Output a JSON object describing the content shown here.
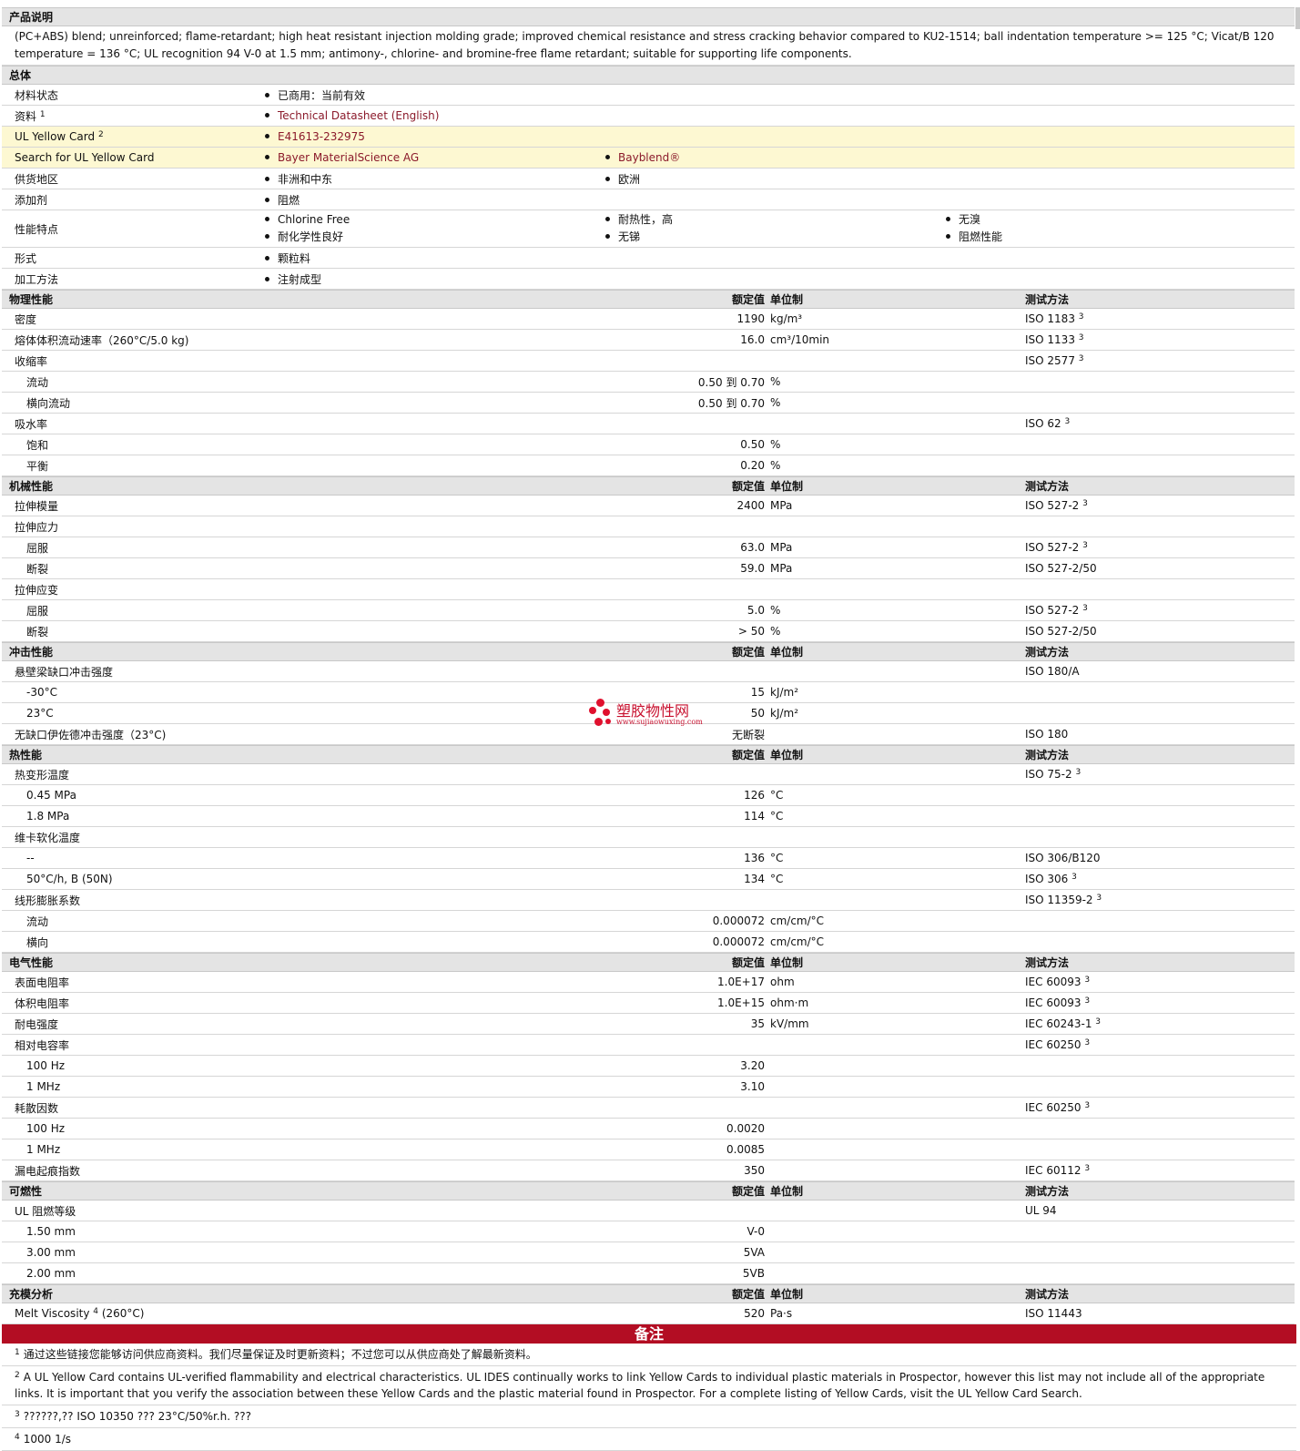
{
  "description": {
    "heading": "产品说明",
    "text": "(PC+ABS) blend; unreinforced; flame-retardant; high heat resistant injection molding grade; improved chemical resistance and stress cracking behavior compared to KU2-1514; ball indentation temperature >= 125 °C; Vicat/B 120 temperature = 136 °C; UL recognition 94 V-0 at 1.5 mm; antimony-, chlorine- and bromine-free flame retardant; suitable for supporting life components."
  },
  "general": {
    "heading": "总体",
    "rows": [
      {
        "label": "材料状态",
        "sup": "",
        "cols": [
          [
            "已商用：当前有效"
          ]
        ],
        "link": false,
        "yellow": false
      },
      {
        "label": "资料",
        "sup": "1",
        "cols": [
          [
            "Technical Datasheet (English)"
          ]
        ],
        "link": true,
        "yellow": false
      },
      {
        "label": "UL Yellow Card",
        "sup": "2",
        "cols": [
          [
            "E41613-232975"
          ]
        ],
        "link": true,
        "yellow": true
      },
      {
        "label": "Search for UL Yellow Card",
        "sup": "",
        "cols": [
          [
            "Bayer MaterialScience AG"
          ],
          [
            "Bayblend®"
          ]
        ],
        "link": true,
        "yellow": true
      },
      {
        "label": "供货地区",
        "sup": "",
        "cols": [
          [
            "非洲和中东"
          ],
          [
            "欧洲"
          ]
        ],
        "link": false,
        "yellow": false
      },
      {
        "label": "添加剂",
        "sup": "",
        "cols": [
          [
            "阻燃"
          ]
        ],
        "link": false,
        "yellow": false
      },
      {
        "label": "性能特点",
        "sup": "",
        "cols": [
          [
            "Chlorine Free",
            "耐化学性良好"
          ],
          [
            "耐热性，高",
            "无锑"
          ],
          [
            "无溴",
            "阻燃性能"
          ]
        ],
        "link": false,
        "yellow": false
      },
      {
        "label": "形式",
        "sup": "",
        "cols": [
          [
            "颗粒料"
          ]
        ],
        "link": false,
        "yellow": false
      },
      {
        "label": "加工方法",
        "sup": "",
        "cols": [
          [
            "注射成型"
          ]
        ],
        "link": false,
        "yellow": false
      }
    ]
  },
  "col_headers": {
    "value": "额定值",
    "unit": "单位制",
    "test": "测试方法"
  },
  "sections": [
    {
      "title": "物理性能",
      "rows": [
        {
          "label": "密度",
          "sub": false,
          "value": "1190",
          "unit": "kg/m³",
          "test": "ISO 1183",
          "sup": "3"
        },
        {
          "label": "熔体体积流动速率（260°C/5.0 kg)",
          "sub": false,
          "value": "16.0",
          "unit": "cm³/10min",
          "test": "ISO 1133",
          "sup": "3"
        },
        {
          "label": "收缩率",
          "sub": false,
          "value": "",
          "unit": "",
          "test": "ISO 2577",
          "sup": "3"
        },
        {
          "label": "流动",
          "sub": true,
          "value": "0.50 到 0.70",
          "unit": "%",
          "test": "",
          "sup": ""
        },
        {
          "label": "横向流动",
          "sub": true,
          "value": "0.50 到 0.70",
          "unit": "%",
          "test": "",
          "sup": ""
        },
        {
          "label": "吸水率",
          "sub": false,
          "value": "",
          "unit": "",
          "test": "ISO 62",
          "sup": "3"
        },
        {
          "label": "饱和",
          "sub": true,
          "value": "0.50",
          "unit": "%",
          "test": "",
          "sup": ""
        },
        {
          "label": "平衡",
          "sub": true,
          "value": "0.20",
          "unit": "%",
          "test": "",
          "sup": ""
        }
      ]
    },
    {
      "title": "机械性能",
      "rows": [
        {
          "label": "拉伸模量",
          "sub": false,
          "value": "2400",
          "unit": "MPa",
          "test": "ISO 527-2",
          "sup": "3"
        },
        {
          "label": "拉伸应力",
          "sub": false,
          "value": "",
          "unit": "",
          "test": "",
          "sup": ""
        },
        {
          "label": "屈服",
          "sub": true,
          "value": "63.0",
          "unit": "MPa",
          "test": "ISO 527-2",
          "sup": "3"
        },
        {
          "label": "断裂",
          "sub": true,
          "value": "59.0",
          "unit": "MPa",
          "test": "ISO 527-2/50",
          "sup": ""
        },
        {
          "label": "拉伸应变",
          "sub": false,
          "value": "",
          "unit": "",
          "test": "",
          "sup": ""
        },
        {
          "label": "屈服",
          "sub": true,
          "value": "5.0",
          "unit": "%",
          "test": "ISO 527-2",
          "sup": "3"
        },
        {
          "label": "断裂",
          "sub": true,
          "value": "> 50",
          "unit": "%",
          "test": "ISO 527-2/50",
          "sup": ""
        }
      ]
    },
    {
      "title": "冲击性能",
      "rows": [
        {
          "label": "悬壁梁缺口冲击强度",
          "sub": false,
          "value": "",
          "unit": "",
          "test": "ISO 180/A",
          "sup": ""
        },
        {
          "label": "-30°C",
          "sub": true,
          "value": "15",
          "unit": "kJ/m²",
          "test": "",
          "sup": ""
        },
        {
          "label": "23°C",
          "sub": true,
          "value": "50",
          "unit": "kJ/m²",
          "test": "",
          "sup": ""
        },
        {
          "label": "无缺口伊佐德冲击强度（23°C)",
          "sub": false,
          "value": "无断裂",
          "unit": "",
          "test": "ISO 180",
          "sup": ""
        }
      ]
    },
    {
      "title": "热性能",
      "rows": [
        {
          "label": "热变形温度",
          "sub": false,
          "value": "",
          "unit": "",
          "test": "ISO 75-2",
          "sup": "3"
        },
        {
          "label": "0.45 MPa",
          "sub": true,
          "value": "126",
          "unit": "°C",
          "test": "",
          "sup": ""
        },
        {
          "label": "1.8 MPa",
          "sub": true,
          "value": "114",
          "unit": "°C",
          "test": "",
          "sup": ""
        },
        {
          "label": "维卡软化温度",
          "sub": false,
          "value": "",
          "unit": "",
          "test": "",
          "sup": ""
        },
        {
          "label": "--",
          "sub": true,
          "value": "136",
          "unit": "°C",
          "test": "ISO 306/B120",
          "sup": ""
        },
        {
          "label": "50°C/h, B (50N)",
          "sub": true,
          "value": "134",
          "unit": "°C",
          "test": "ISO 306",
          "sup": "3"
        },
        {
          "label": "线形膨胀系数",
          "sub": false,
          "value": "",
          "unit": "",
          "test": "ISO 11359-2",
          "sup": "3"
        },
        {
          "label": "流动",
          "sub": true,
          "value": "0.000072",
          "unit": "cm/cm/°C",
          "test": "",
          "sup": ""
        },
        {
          "label": "横向",
          "sub": true,
          "value": "0.000072",
          "unit": "cm/cm/°C",
          "test": "",
          "sup": ""
        }
      ]
    },
    {
      "title": "电气性能",
      "rows": [
        {
          "label": "表面电阻率",
          "sub": false,
          "value": "1.0E+17",
          "unit": "ohm",
          "test": "IEC 60093",
          "sup": "3"
        },
        {
          "label": "体积电阻率",
          "sub": false,
          "value": "1.0E+15",
          "unit": "ohm·m",
          "test": "IEC 60093",
          "sup": "3"
        },
        {
          "label": "耐电强度",
          "sub": false,
          "value": "35",
          "unit": "kV/mm",
          "test": "IEC 60243-1",
          "sup": "3"
        },
        {
          "label": "相对电容率",
          "sub": false,
          "value": "",
          "unit": "",
          "test": "IEC 60250",
          "sup": "3"
        },
        {
          "label": "100 Hz",
          "sub": true,
          "value": "3.20",
          "unit": "",
          "test": "",
          "sup": ""
        },
        {
          "label": "1 MHz",
          "sub": true,
          "value": "3.10",
          "unit": "",
          "test": "",
          "sup": ""
        },
        {
          "label": "耗散因数",
          "sub": false,
          "value": "",
          "unit": "",
          "test": "IEC 60250",
          "sup": "3"
        },
        {
          "label": "100 Hz",
          "sub": true,
          "value": "0.0020",
          "unit": "",
          "test": "",
          "sup": ""
        },
        {
          "label": "1 MHz",
          "sub": true,
          "value": "0.0085",
          "unit": "",
          "test": "",
          "sup": ""
        },
        {
          "label": "漏电起痕指数",
          "sub": false,
          "value": "350",
          "unit": "",
          "test": "IEC 60112",
          "sup": "3"
        }
      ]
    },
    {
      "title": "可燃性",
      "rows": [
        {
          "label": "UL 阻燃等级",
          "sub": false,
          "value": "",
          "unit": "",
          "test": "UL 94",
          "sup": ""
        },
        {
          "label": "1.50 mm",
          "sub": true,
          "value": "V-0",
          "unit": "",
          "test": "",
          "sup": ""
        },
        {
          "label": "3.00 mm",
          "sub": true,
          "value": "5VA",
          "unit": "",
          "test": "",
          "sup": ""
        },
        {
          "label": "2.00 mm",
          "sub": true,
          "value": "5VB",
          "unit": "",
          "test": "",
          "sup": ""
        }
      ]
    },
    {
      "title": "充模分析",
      "rows": [
        {
          "label": "Melt Viscosity",
          "labelsup": "4",
          "labelsuffix": "(260°C)",
          "sub": false,
          "value": "520",
          "unit": "Pa·s",
          "test": "ISO 11443",
          "sup": ""
        }
      ]
    }
  ],
  "notes": {
    "heading": "备注",
    "items": [
      {
        "num": "1",
        "text": "通过这些链接您能够访问供应商资料。我们尽量保证及时更新资料；不过您可以从供应商处了解最新资料。"
      },
      {
        "num": "2",
        "text": "A UL Yellow Card contains UL-verified flammability and electrical characteristics. UL IDES continually works to link Yellow Cards to individual plastic materials in Prospector, however this list may not include all of the appropriate links. It is important that you verify the association between these Yellow Cards and the plastic material found in Prospector. For a complete listing of Yellow Cards, visit the UL Yellow Card Search."
      },
      {
        "num": "3",
        "text": "??????,?? ISO 10350 ??? 23°C/50%r.h. ???"
      },
      {
        "num": "4",
        "text": "1000 1/s"
      }
    ]
  },
  "watermark": {
    "text": "塑胶物性网",
    "url": "www.sujiaowuxing.com"
  }
}
